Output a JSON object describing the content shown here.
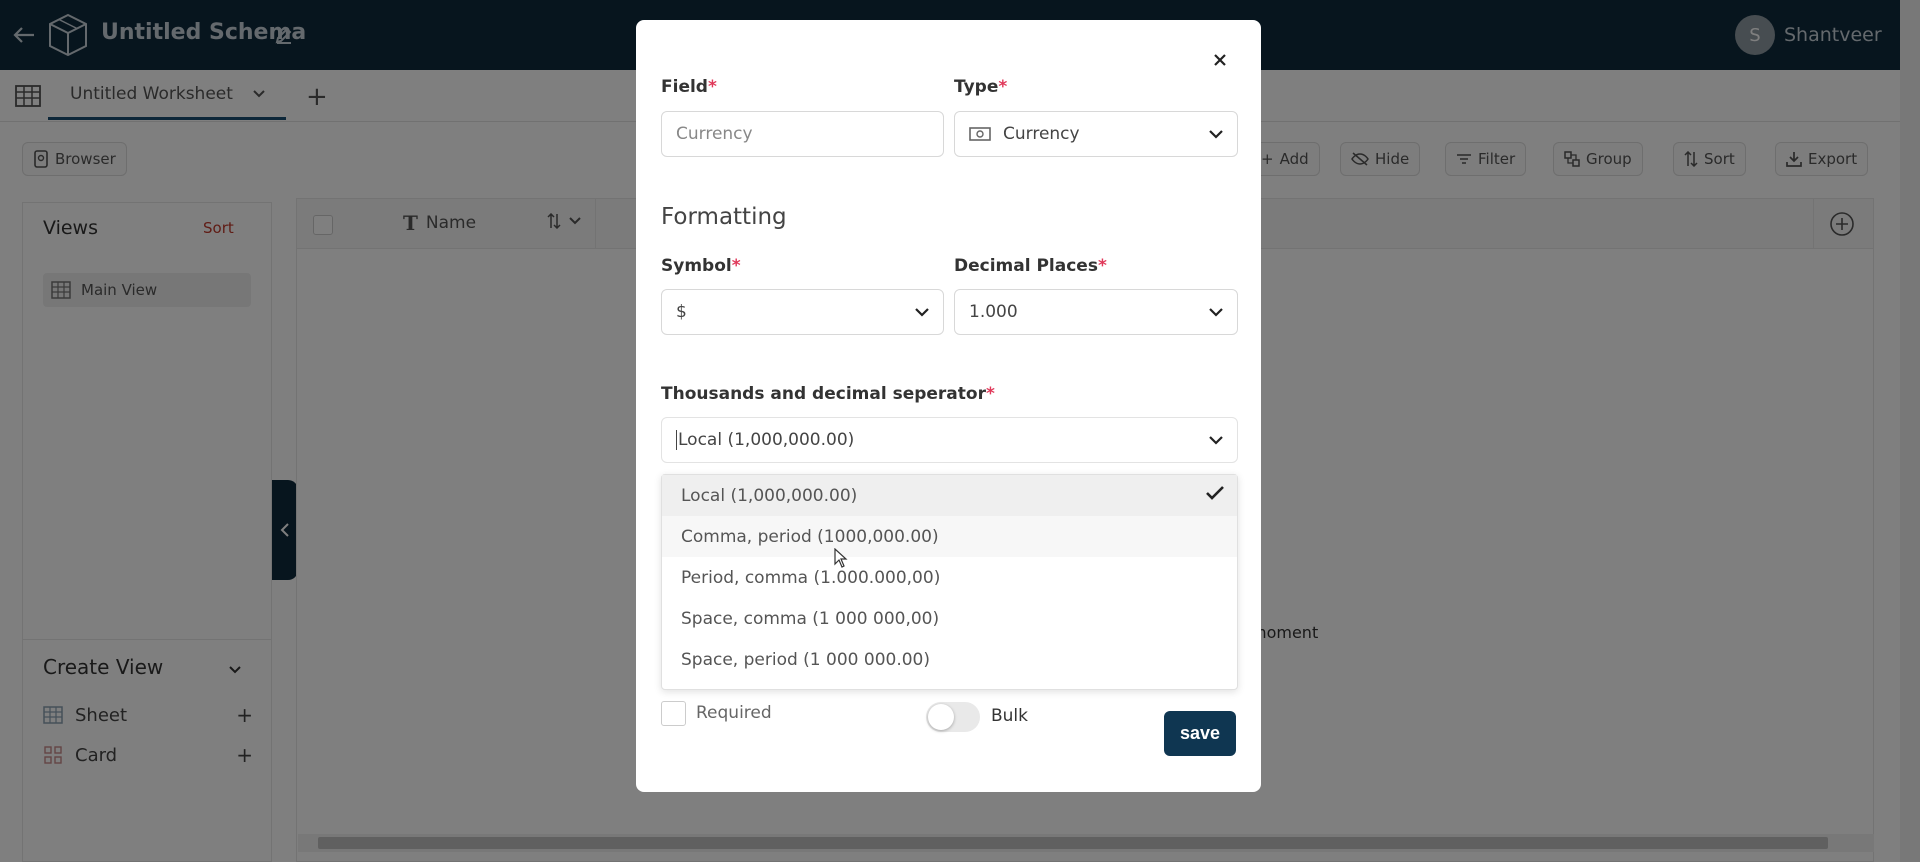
{
  "header": {
    "schema_title": "Untitled Schema",
    "avatar_initial": "S",
    "username": "Shantveer"
  },
  "tabbar": {
    "worksheet_label": "Untitled Worksheet",
    "add_worksheet": "+"
  },
  "toolbar": {
    "browser": "Browser",
    "add": "Add",
    "hide": "Hide",
    "filter": "Filter",
    "group": "Group",
    "sort": "Sort",
    "export": "Export"
  },
  "views": {
    "title": "Views",
    "sort_label": "Sort",
    "main_view": "Main View",
    "create_view_title": "Create View",
    "items": [
      {
        "label": "Sheet",
        "plus": "+"
      },
      {
        "label": "Card",
        "plus": "+"
      }
    ]
  },
  "grid": {
    "name_column": "Name",
    "message_fragment": "moment"
  },
  "modal": {
    "field_label": "Field",
    "field_value": "Currency",
    "type_label": "Type",
    "type_value": "Currency",
    "formatting_title": "Formatting",
    "symbol_label": "Symbol",
    "symbol_value": "$",
    "decimal_label": "Decimal Places",
    "decimal_value": "1.000",
    "separator_label": "Thousands and decimal seperator",
    "separator_value": "Local (1,000,000.00)",
    "required_mark": "*",
    "options": [
      "Local (1,000,000.00)",
      "Comma, period (1000,000.00)",
      "Period, comma (1.000.000,00)",
      "Space, comma (1 000 000,00)",
      "Space, period (1 000 000.00)"
    ],
    "selected_option_index": 0,
    "required_label": "Required",
    "bulk_label": "Bulk",
    "save_label": "save"
  },
  "colors": {
    "topbar": "#0f2a3c",
    "accent": "#0f3651",
    "required": "#e0395a",
    "sort_link": "#c0392b"
  }
}
